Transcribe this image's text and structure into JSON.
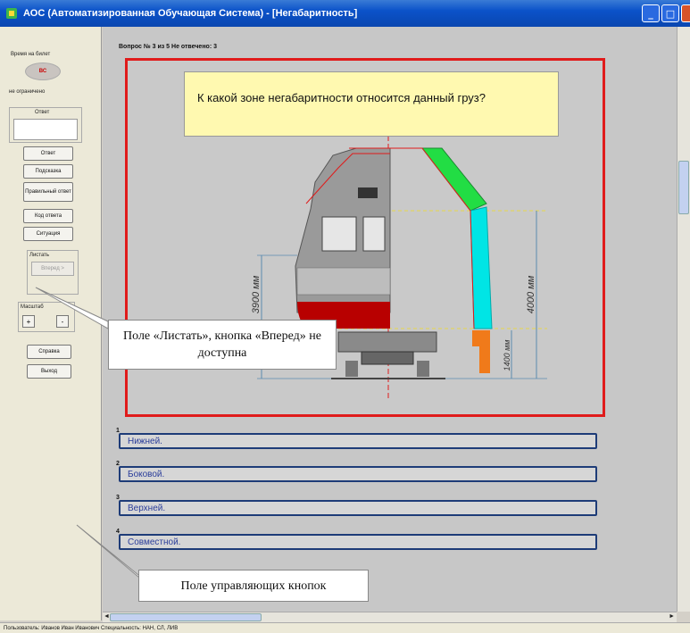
{
  "window": {
    "title": "АОС (Автоматизированная Обучающая Система) - [Негабаритность]",
    "buttons": {
      "minimize": "_",
      "maximize": "□",
      "close": "X"
    }
  },
  "sidebar": {
    "time_label": "Время на билет",
    "time_value": "ВС",
    "time_limit": "не ограничено",
    "answer_label": "Ответ",
    "buttons": {
      "answer": "Ответ",
      "hint": "Подсказка",
      "correct_answer": "Правильный ответ",
      "answer_code": "Код ответа",
      "situation": "Ситуация",
      "help": "Справка",
      "exit": "Выход"
    },
    "scroll_label": "Листать",
    "forward_button": "Вперед >",
    "scale_label": "Масштаб",
    "scale_plus": "+",
    "scale_minus": "-"
  },
  "main": {
    "question_header": "Вопрос № 3 из 5   Не отвечено: 3",
    "question_text": "К какой зоне негабаритности относится данный груз?",
    "dimensions": {
      "height_left": "3900 мм",
      "height_right": "4000 мм",
      "base_right": "1400 мм"
    },
    "answers": [
      {
        "number": "1",
        "text": "Нижней."
      },
      {
        "number": "2",
        "text": "Боковой."
      },
      {
        "number": "3",
        "text": "Верхней."
      },
      {
        "number": "4",
        "text": "Совместной."
      }
    ]
  },
  "scrollbars": {
    "left_arrow": "◄",
    "right_arrow": "►"
  },
  "statusbar": {
    "text": "Пользователь: Иванов Иван Иванович   Специальность: НАН, СЛ, ЛИВ"
  },
  "annotations": {
    "scroll_field": "Поле «Листать», кнопка «Вперед» не доступна",
    "control_field": "Поле управляющих кнопок"
  },
  "colors": {
    "frame_red": "#e01b1b",
    "question_bg": "#fff9b0",
    "answer_border": "#1e3c78",
    "answer_text": "#2a3d9a",
    "roof_green": "#22dd44",
    "cab_cyan": "#00e5e5",
    "hull_red": "#b80000",
    "step_orange": "#f07a1a"
  }
}
